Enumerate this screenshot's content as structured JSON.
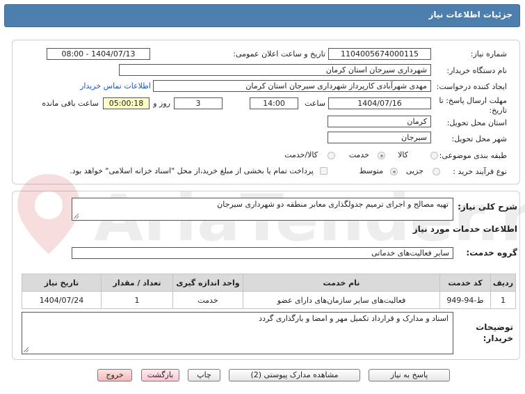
{
  "header": {
    "title": "جزئیات اطلاعات نیاز"
  },
  "fields": {
    "need_number_label": "شماره نیاز:",
    "need_number": "1104005674000115",
    "announce_label": "تاریخ و ساعت اعلان عمومی:",
    "announce_value": "1404/07/13 - 08:00",
    "buyer_org_label": "نام دستگاه خریدار:",
    "buyer_org": "شهرداری سیرجان استان کرمان",
    "creator_label": "ایجاد کننده درخواست:",
    "creator": "مهدی شهرآبادی کارپرداز شهرداری سیرجان استان کرمان",
    "contact_link": "اطلاعات تماس خریدار",
    "deadline_label_1": "مهلت ارسال پاسخ: تا",
    "deadline_label_2": "تاریخ:",
    "deadline_date": "1404/07/16",
    "time_label": "ساعت",
    "deadline_time": "14:00",
    "days_value": "3",
    "days_label": "روز و",
    "remaining_time": "05:00:18",
    "remaining_label": "ساعت باقی مانده",
    "province_label": "استان محل تحویل:",
    "province": "کرمان",
    "city_label": "شهر محل تحویل:",
    "city": "سیرجان",
    "category_label": "طبقه بندی موضوعی:",
    "category_options": [
      "کالا",
      "خدمت",
      "کالا/خدمت"
    ],
    "category_selected": "خدمت",
    "process_label": "نوع فرآیند خرید :",
    "process_options": [
      "جزیی",
      "متوسط"
    ],
    "process_selected": "متوسط",
    "payment_note": "پرداخت تمام یا بخشی از مبلغ خرید،از محل \"اسناد خزانه اسلامی\" خواهد بود."
  },
  "summary": {
    "label": "شرح کلی نیاز:",
    "value": "تهیه مصالح و اجرای ترمیم جدولگذاری معابر منطقه دو شهرداری سیرجان"
  },
  "services": {
    "section_title": "اطلاعات خدمات مورد نیاز",
    "group_label": "گروه خدمت:",
    "group_value": "سایر فعالیت‌های خدماتی",
    "columns": [
      "ردیف",
      "کد خدمت",
      "نام خدمت",
      "واحد اندازه گیری",
      "تعداد / مقدار",
      "تاریخ نیاز"
    ],
    "rows": [
      {
        "index": "1",
        "code": "ط-94-949",
        "name": "فعالیت‌های سایر سازمان‌های دارای عضو",
        "unit": "خدمت",
        "qty": "1",
        "date": "1404/07/24"
      }
    ]
  },
  "buyer_notes": {
    "label_1": "توضیحات",
    "label_2": "خریدار:",
    "value": "اسناد و مدارک و قرارداد تکمیل مهر و امضا و بارگذاری گردد"
  },
  "buttons": {
    "reply": "پاسخ به نیاز",
    "attachments": "مشاهده مدارک پیوستی (2)",
    "print": "چاپ",
    "back": "بازگشت",
    "exit": "خروج"
  },
  "watermark": {
    "text": "AriaTender.net"
  },
  "colors": {
    "header": "#4d7fae",
    "highlight": "#ffffc4",
    "link": "#1a55c8"
  }
}
